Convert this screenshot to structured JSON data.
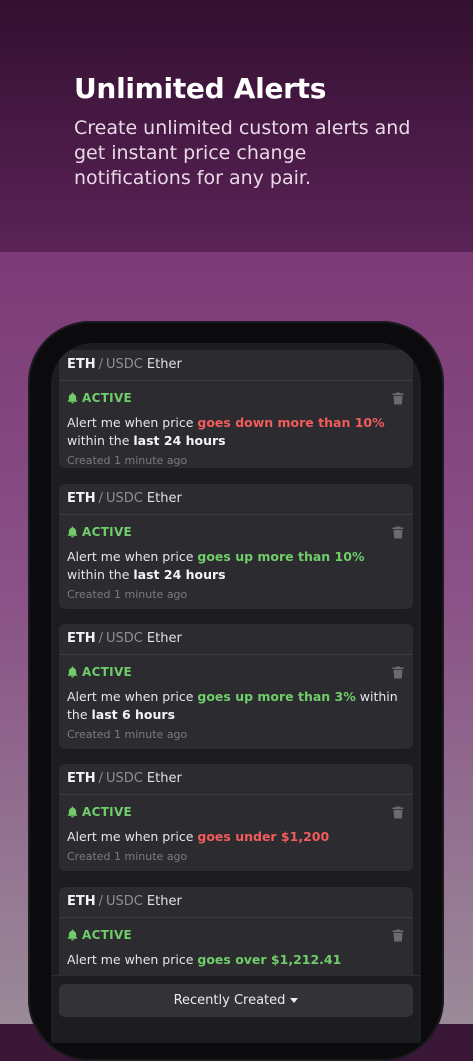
{
  "hero": {
    "title": "Unlimited Alerts",
    "subtitle": "Create unlimited custom alerts and get instant price change notifications for any pair."
  },
  "alerts": [
    {
      "symbol": "ETH",
      "separator": "/",
      "quote": "USDC",
      "name": "Ether",
      "status": "ACTIVE",
      "text_prefix": "Alert me when price ",
      "condition": "goes down more than 10%",
      "condition_color": "#f25c5c",
      "text_middle": " within the ",
      "period": "last 24 hours",
      "created": "Created 1 minute ago"
    },
    {
      "symbol": "ETH",
      "separator": "/",
      "quote": "USDC",
      "name": "Ether",
      "status": "ACTIVE",
      "text_prefix": "Alert me when price ",
      "condition": "goes up more than 10%",
      "condition_color": "#6fcd6a",
      "text_middle": " within the ",
      "period": "last 24 hours",
      "created": "Created 1 minute ago"
    },
    {
      "symbol": "ETH",
      "separator": "/",
      "quote": "USDC",
      "name": "Ether",
      "status": "ACTIVE",
      "text_prefix": "Alert me when price ",
      "condition": "goes up more than 3%",
      "condition_color": "#6fcd6a",
      "text_middle": " within the ",
      "period": "last 6 hours",
      "created": "Created 1 minute ago"
    },
    {
      "symbol": "ETH",
      "separator": "/",
      "quote": "USDC",
      "name": "Ether",
      "status": "ACTIVE",
      "text_prefix": "Alert me when price ",
      "condition": "goes under $1,200",
      "condition_color": "#f25c5c",
      "created": "Created 1 minute ago"
    },
    {
      "symbol": "ETH",
      "separator": "/",
      "quote": "USDC",
      "name": "Ether",
      "status": "ACTIVE",
      "text_prefix": "Alert me when price ",
      "condition": "goes over $1,212.41",
      "condition_color": "#6fcd6a"
    }
  ],
  "sort": {
    "label": "Recently Created"
  },
  "icons": {
    "status": "bell-icon",
    "delete": "trash-icon",
    "sort": "caret-down-icon"
  },
  "colors": {
    "active": "#6fcd6a",
    "down": "#f25c5c",
    "up": "#6fcd6a"
  }
}
